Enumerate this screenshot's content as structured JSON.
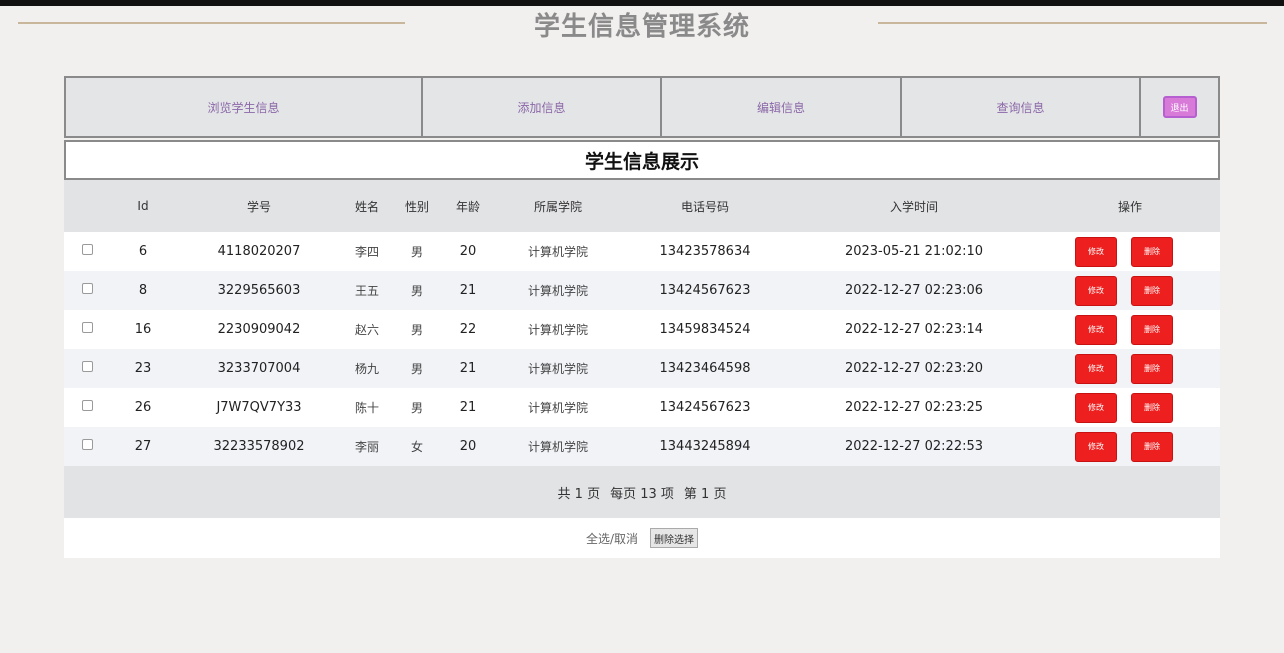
{
  "header": {
    "title": "学生信息管理系统"
  },
  "nav": {
    "browse": "浏览学生信息",
    "add": "添加信息",
    "edit": "编辑信息",
    "search": "查询信息",
    "exit": "退出"
  },
  "section_title": "学生信息展示",
  "table": {
    "columns": [
      "Id",
      "学号",
      "姓名",
      "性别",
      "年龄",
      "所属学院",
      "电话号码",
      "入学时间",
      "操作"
    ],
    "rows": [
      {
        "id": "6",
        "student_no": "4118020207",
        "name": "李四",
        "gender": "男",
        "age": "20",
        "college": "计算机学院",
        "phone": "13423578634",
        "enroll_time": "2023-05-21 21:02:10"
      },
      {
        "id": "8",
        "student_no": "3229565603",
        "name": "王五",
        "gender": "男",
        "age": "21",
        "college": "计算机学院",
        "phone": "13424567623",
        "enroll_time": "2022-12-27 02:23:06"
      },
      {
        "id": "16",
        "student_no": "2230909042",
        "name": "赵六",
        "gender": "男",
        "age": "22",
        "college": "计算机学院",
        "phone": "13459834524",
        "enroll_time": "2022-12-27 02:23:14"
      },
      {
        "id": "23",
        "student_no": "3233707004",
        "name": "杨九",
        "gender": "男",
        "age": "21",
        "college": "计算机学院",
        "phone": "13423464598",
        "enroll_time": "2022-12-27 02:23:20"
      },
      {
        "id": "26",
        "student_no": "J7W7QV7Y33",
        "name": "陈十",
        "gender": "男",
        "age": "21",
        "college": "计算机学院",
        "phone": "13424567623",
        "enroll_time": "2022-12-27 02:23:25"
      },
      {
        "id": "27",
        "student_no": "32233578902",
        "name": "李丽",
        "gender": "女",
        "age": "20",
        "college": "计算机学院",
        "phone": "13443245894",
        "enroll_time": "2022-12-27 02:22:53"
      }
    ],
    "edit_label": "修改",
    "delete_label": "删除"
  },
  "pager": {
    "total_pages": "共 1 页",
    "per_page": "每页 13 项",
    "current_page": "第 1 页"
  },
  "footer": {
    "select_all": "全选/取消",
    "delete_selected": "删除选择"
  }
}
